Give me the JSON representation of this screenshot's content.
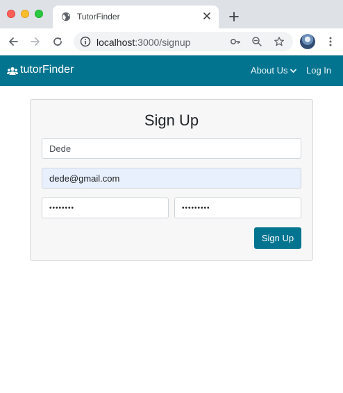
{
  "browser": {
    "tab_title": "TutorFinder",
    "url_host": "localhost",
    "url_path": ":3000/signup",
    "icons": [
      "globe-icon",
      "close-icon",
      "plus-icon",
      "back-arrow-icon",
      "forward-arrow-icon",
      "reload-icon",
      "info-icon",
      "key-icon",
      "zoom-out-icon",
      "star-icon",
      "profile-avatar",
      "more-vert-icon"
    ]
  },
  "navbar": {
    "brand": "tutorFinder",
    "brand_icon": "users-icon",
    "about_label": "About Us",
    "login_label": "Log In",
    "color": "#03748f"
  },
  "form": {
    "title": "Sign Up",
    "name_value": "Dede",
    "email_value": "dede@gmail.com",
    "password_value": "••••••••",
    "confirm_password_value": "•••••••••",
    "submit_label": "Sign Up"
  }
}
